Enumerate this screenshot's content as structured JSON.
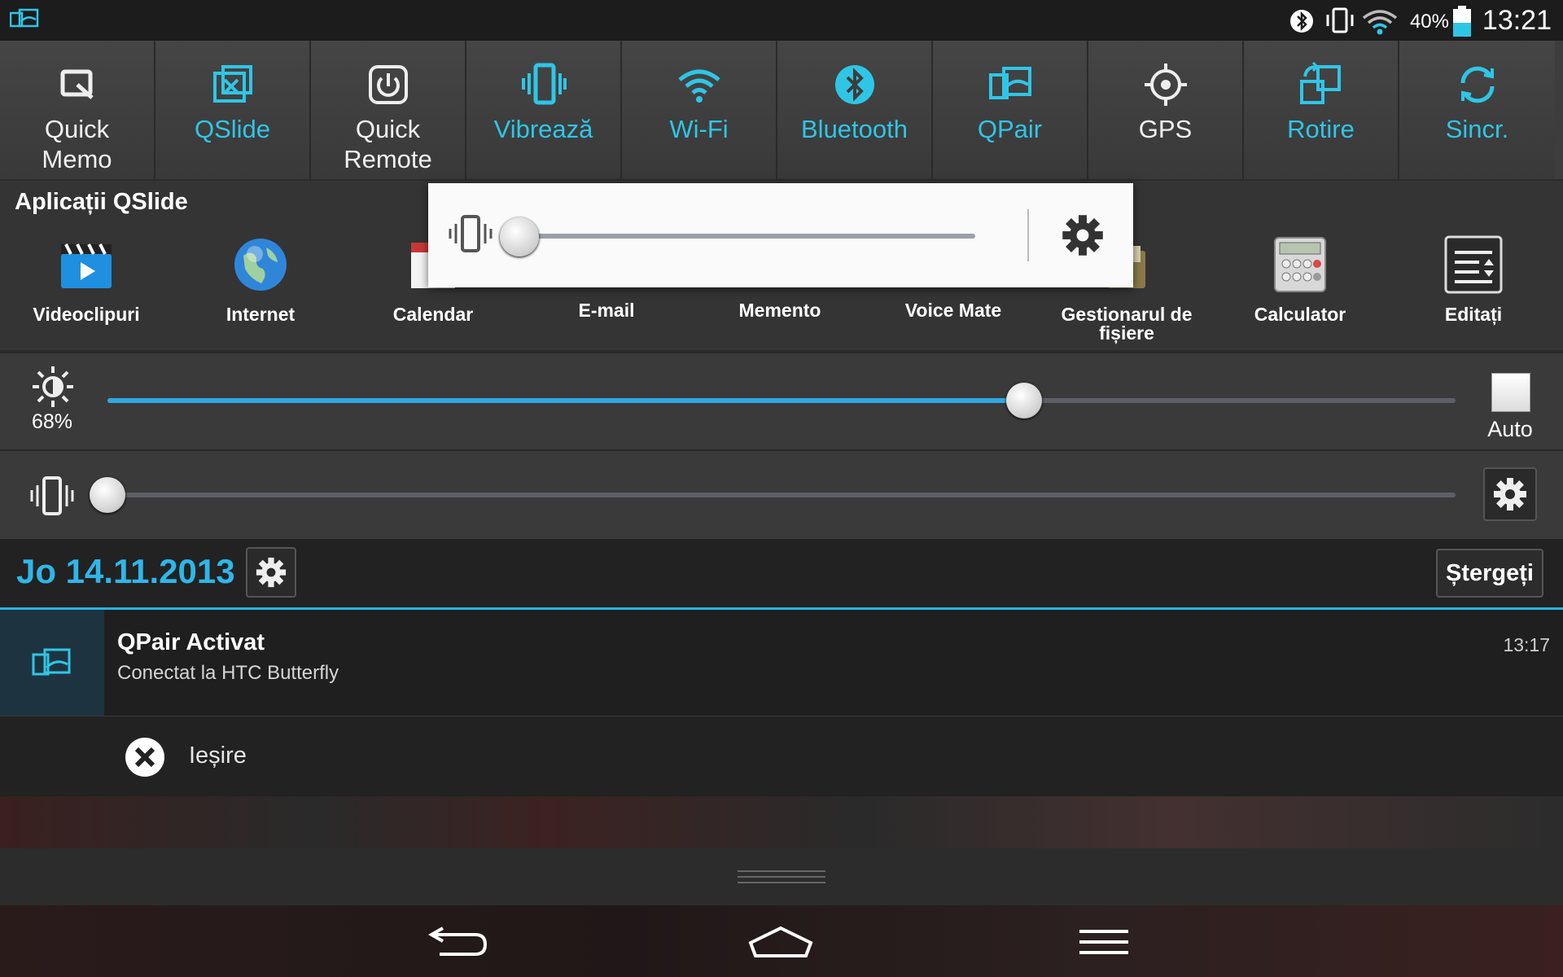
{
  "status_bar": {
    "battery_percent": "40%",
    "time": "13:21",
    "icons": [
      "qpair-icon",
      "bluetooth-icon",
      "vibrate-icon",
      "wifi-icon",
      "battery-icon"
    ]
  },
  "quick_toggles": [
    {
      "line1": "Quick",
      "line2": "Memo",
      "active": false,
      "icon": "quick-memo-icon"
    },
    {
      "line1": "QSlide",
      "line2": "",
      "active": true,
      "icon": "qslide-icon"
    },
    {
      "line1": "Quick",
      "line2": "Remote",
      "active": false,
      "icon": "quick-remote-icon"
    },
    {
      "line1": "Vibrează",
      "line2": "",
      "active": true,
      "icon": "vibrate-icon"
    },
    {
      "line1": "Wi-Fi",
      "line2": "",
      "active": true,
      "icon": "wifi-icon"
    },
    {
      "line1": "Bluetooth",
      "line2": "",
      "active": true,
      "icon": "bluetooth-icon"
    },
    {
      "line1": "QPair",
      "line2": "",
      "active": true,
      "icon": "qpair-icon"
    },
    {
      "line1": "GPS",
      "line2": "",
      "active": false,
      "icon": "gps-icon"
    },
    {
      "line1": "Rotire",
      "line2": "",
      "active": true,
      "icon": "rotate-icon"
    },
    {
      "line1": "Sincr.",
      "line2": "",
      "active": true,
      "icon": "sync-icon"
    }
  ],
  "qslide": {
    "title": "Aplicații QSlide",
    "apps": [
      {
        "line1": "Videoclipuri",
        "line2": "",
        "icon": "video-icon"
      },
      {
        "line1": "Internet",
        "line2": "",
        "icon": "globe-icon"
      },
      {
        "line1": "Calendar",
        "line2": "",
        "icon": "calendar-icon"
      },
      {
        "line1": "E-mail",
        "line2": "",
        "icon": "email-icon"
      },
      {
        "line1": "Memento",
        "line2": "",
        "icon": "memo-icon"
      },
      {
        "line1": "Voice Mate",
        "line2": "",
        "icon": "voice-icon"
      },
      {
        "line1": "Gestionarul de",
        "line2": "fișiere",
        "icon": "file-manager-icon"
      },
      {
        "line1": "Calculator",
        "line2": "",
        "icon": "calculator-icon"
      },
      {
        "line1": "Editați",
        "line2": "",
        "icon": "edit-list-icon"
      }
    ]
  },
  "brightness": {
    "value_label": "68%",
    "level": 0.68,
    "auto_label": "Auto"
  },
  "volume": {
    "level": 0.0
  },
  "date_row": {
    "date": "Jo 14.11.2013",
    "clear_label": "Ștergeți"
  },
  "notification": {
    "title": "QPair Activat",
    "text": "Conectat la HTC Butterfly",
    "time": "13:17"
  },
  "exit_action": {
    "label": "Ieșire"
  },
  "popup": {
    "level": 0.0
  },
  "colors": {
    "accent": "#2fc6e6",
    "panel": "#3a3a3a",
    "date": "#2fb6e8",
    "popup_bg": "#fafafa"
  }
}
